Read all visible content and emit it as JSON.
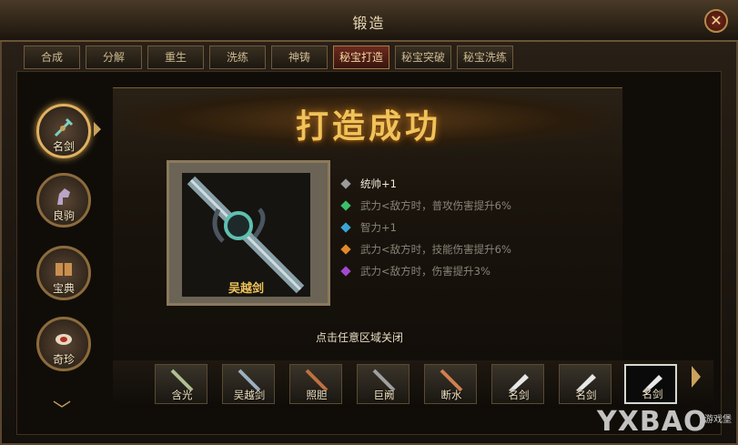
{
  "window": {
    "title": "锻造",
    "close_glyph": "✕"
  },
  "tabs": [
    {
      "label": "合成",
      "active": false
    },
    {
      "label": "分解",
      "active": false
    },
    {
      "label": "重生",
      "active": false
    },
    {
      "label": "洗练",
      "active": false
    },
    {
      "label": "神铸",
      "active": false
    },
    {
      "label": "秘宝打造",
      "active": true
    },
    {
      "label": "秘宝突破",
      "active": false
    },
    {
      "label": "秘宝洗练",
      "active": false
    }
  ],
  "sidebar": {
    "items": [
      {
        "label": "名剑",
        "icon": "sword-icon",
        "active": true
      },
      {
        "label": "良驹",
        "icon": "horse-icon",
        "active": false
      },
      {
        "label": "宝典",
        "icon": "book-icon",
        "active": false
      },
      {
        "label": "奇珍",
        "icon": "feather-icon",
        "active": false
      }
    ],
    "down_icon": "chevron-down-icon"
  },
  "result": {
    "banner": "打造成功",
    "item_name": "吴越剑",
    "item_icon": "sword-icon",
    "stats": [
      {
        "text": "统帅+1",
        "color": "#9a9a9a",
        "text_color": "#f0ead8"
      },
      {
        "text": "武力<敌方时，普攻伤害提升6%",
        "color": "#3bbf6a",
        "text_color": "#8a8478"
      },
      {
        "text": "智力+1",
        "color": "#3aa6d8",
        "text_color": "#8a8478"
      },
      {
        "text": "武力<敌方时，技能伤害提升6%",
        "color": "#e08a2a",
        "text_color": "#8a8478"
      },
      {
        "text": "武力<敌方时，伤害提升3%",
        "color": "#a04ad0",
        "text_color": "#8a8478"
      }
    ],
    "close_hint": "点击任意区域关闭"
  },
  "item_strip": [
    {
      "label": "含光",
      "icon": "sword-icon",
      "locked": false,
      "selected": false
    },
    {
      "label": "吴越剑",
      "icon": "sword-icon",
      "locked": false,
      "selected": false
    },
    {
      "label": "照胆",
      "icon": "sword-icon",
      "locked": false,
      "selected": false
    },
    {
      "label": "巨阙",
      "icon": "sword-icon",
      "locked": false,
      "selected": false
    },
    {
      "label": "断水",
      "icon": "sword-icon",
      "locked": false,
      "selected": false
    },
    {
      "label": "名剑",
      "icon": "locked-sword-icon",
      "locked": true,
      "selected": false
    },
    {
      "label": "名剑",
      "icon": "locked-sword-icon",
      "locked": true,
      "selected": false
    },
    {
      "label": "名剑",
      "icon": "locked-sword-icon",
      "locked": true,
      "selected": true
    }
  ],
  "watermark": {
    "text": "YXBAO",
    "subtext": "游戏堡"
  },
  "colors": {
    "accent_gold": "#f0c35a",
    "active_tab": "#6b2a1e"
  }
}
